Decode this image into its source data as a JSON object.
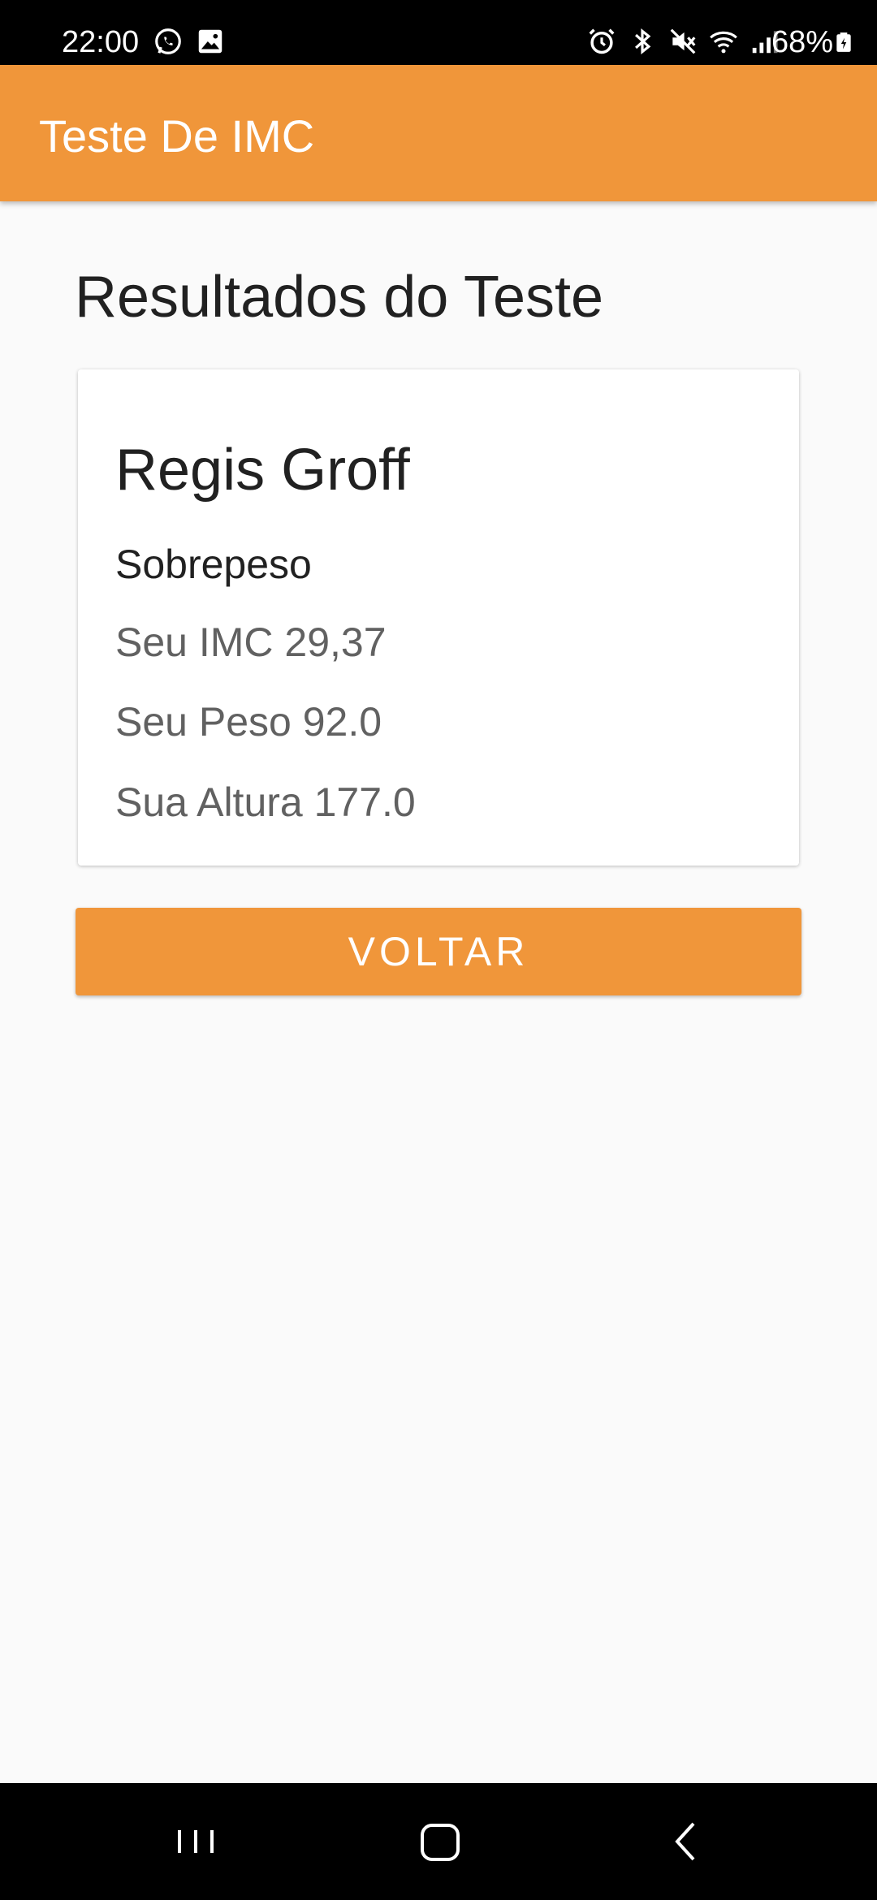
{
  "status_bar": {
    "time": "22:00",
    "battery": "68%",
    "left_icons": [
      "whatsapp-icon",
      "image-icon"
    ],
    "right_icons": [
      "alarm-icon",
      "bluetooth-icon",
      "mute-icon",
      "wifi-icon",
      "signal-icon",
      "battery-icon"
    ]
  },
  "app_bar": {
    "title": "Teste De IMC",
    "color": "#f0963a"
  },
  "main": {
    "title": "Resultados do Teste",
    "result_card": {
      "name": "Regis Groff",
      "category": "Sobrepeso",
      "imc": "Seu IMC 29,37",
      "peso": "Seu Peso 92.0",
      "altura": "Sua Altura 177.0"
    },
    "back_button_label": "VOLTAR"
  },
  "nav_bar": {
    "buttons": [
      "recents-icon",
      "home-icon",
      "back-icon"
    ]
  }
}
